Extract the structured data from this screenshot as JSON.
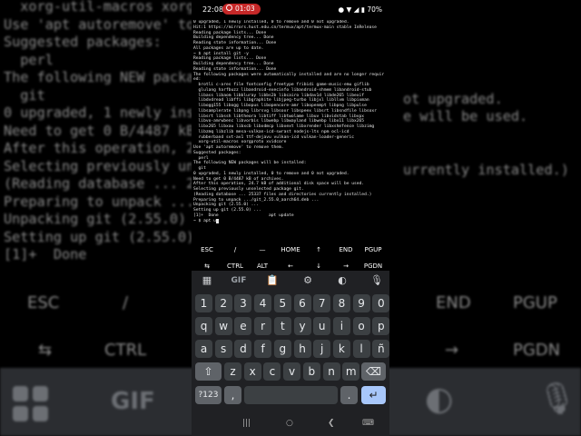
{
  "status_bar": {
    "time": "22:08",
    "record_timer": "01:03",
    "battery": "70%"
  },
  "terminal": {
    "lines": [
      "0 upgraded, 1 newly installed, 0 to remove and 0 not upgraded.",
      "Hit:1 https://mirrors.hust.edu.cn/termux/apt/termux-main stable InRelease",
      "Reading package lists... Done",
      "Building dependency tree... Done",
      "Reading state information... Done",
      "All packages are up to date.",
      "~ $ apt install git -y",
      "Reading package lists... Done",
      "Building dependency tree... Done",
      "Reading state information... Done",
      "The following packages were automatically installed and are no longer requir",
      "ed:",
      "  brotli c-ares file fontconfig freetype fribidi game-music-emu giflib",
      "  glulang harfbuzz libandroid-execinfo libandroid-shmem libandroid-stub",
      "  libass libaom libbluray libbs2b libcairo libdav1d libde265 libexif",
      "  libdvdread libffi libgraphite libjpeg-turbo libjxl libllvm libpixman",
      "  libogg155 libogg libopus libopencore-amr libopenmpt libpng libpulse",
      "  libsamplerate libpng librsvg libsoxr libspeex libsrt libsndfile libsoxr",
      "  libsrt libssh libtheora libtiff libtwolame libuv libvidstab libvpx",
      "  libvo-amrwbenc libvorbis libwebp libwayland libwebp libx11 libx265",
      "  libx265 libxau libxcb libxdmcp libxext libxrender libxshmfence libzimg",
      "  libzmq libzlib mesa-vulkan-icd-swrast nodejs-lts npm ocl-icd",
      "  rubberband svt-av1 ttf-dejavu vulkan-icd vulkan-loader-generic",
      "  xorg-util-macros xorgproto xvidcore",
      "Use 'apt autoremove' to remove them.",
      "Suggested packages:",
      "  perl",
      "The following NEW packages will be installed:",
      "  git",
      "0 upgraded, 1 newly installed, 0 to remove and 0 not upgraded.",
      "Need to get 0 B/4487 kB of archives.",
      "After this operation, 24.7 kB of additional disk space will be used.",
      "Selecting previously unselected package git.",
      "(Reading database ... 25337 files and directories currently installed.)",
      "Preparing to unpack .../git_2.55.0_aarch64.deb ...",
      "Unpacking git (2.55.0) ...",
      "Setting up git (2.55.0) ...",
      "[1]+  Done                    apt update",
      "~ $ apt u"
    ]
  },
  "background_terminal": {
    "lines": [
      "  xorg-util-macros xorgproto",
      "Use 'apt autoremove' to remove",
      "Suggested packages:",
      "  perl",
      "The following NEW packages",
      "  git",
      "0 upgraded, 1 newly install",
      "Need to get 0 B/4487 kB of",
      "After this operation, 24.",
      "Selecting previously unse",
      "(Reading database ... 253",
      "Preparing to unpack .../g",
      "Unpacking git (2.55.0) ..",
      "Setting up git (2.55.0) .",
      "[1]+  Done",
      "~ $ apt u"
    ],
    "right_fragments": [
      "ot upgraded.",
      "e will be used.",
      "urrently installed.)"
    ]
  },
  "extra_keys": {
    "row1": [
      "ESC",
      "/",
      "—",
      "HOME",
      "↑",
      "END",
      "PGUP"
    ],
    "row2": [
      "⇆",
      "CTRL",
      "ALT",
      "←",
      "↓",
      "→",
      "PGDN"
    ]
  },
  "keyboard": {
    "toolbar": [
      "apps-icon",
      "GIF",
      "clipboard-icon",
      "gear-icon",
      "palette-icon",
      "mic-icon"
    ],
    "gif_label": "GIF",
    "numbers": [
      "1",
      "2",
      "3",
      "4",
      "5",
      "6",
      "7",
      "8",
      "9",
      "0"
    ],
    "row1": [
      "q",
      "w",
      "e",
      "r",
      "t",
      "y",
      "u",
      "i",
      "o",
      "p"
    ],
    "row2": [
      "a",
      "s",
      "d",
      "f",
      "g",
      "h",
      "j",
      "k",
      "l",
      "ñ"
    ],
    "row3": [
      "z",
      "x",
      "c",
      "v",
      "b",
      "n",
      "m"
    ],
    "symbols_label": "?123",
    "comma": ",",
    "period": ".",
    "enter_icon": "enter-icon",
    "shift_icon": "shift-icon",
    "backspace_icon": "backspace-icon"
  },
  "nav_bar": [
    "recents-icon",
    "home-icon",
    "back-icon",
    "keyboard-switch-icon"
  ],
  "colors": {
    "record": "#c62828",
    "accent_key": "#a8c7fa",
    "keyboard_bg": "#202124"
  }
}
